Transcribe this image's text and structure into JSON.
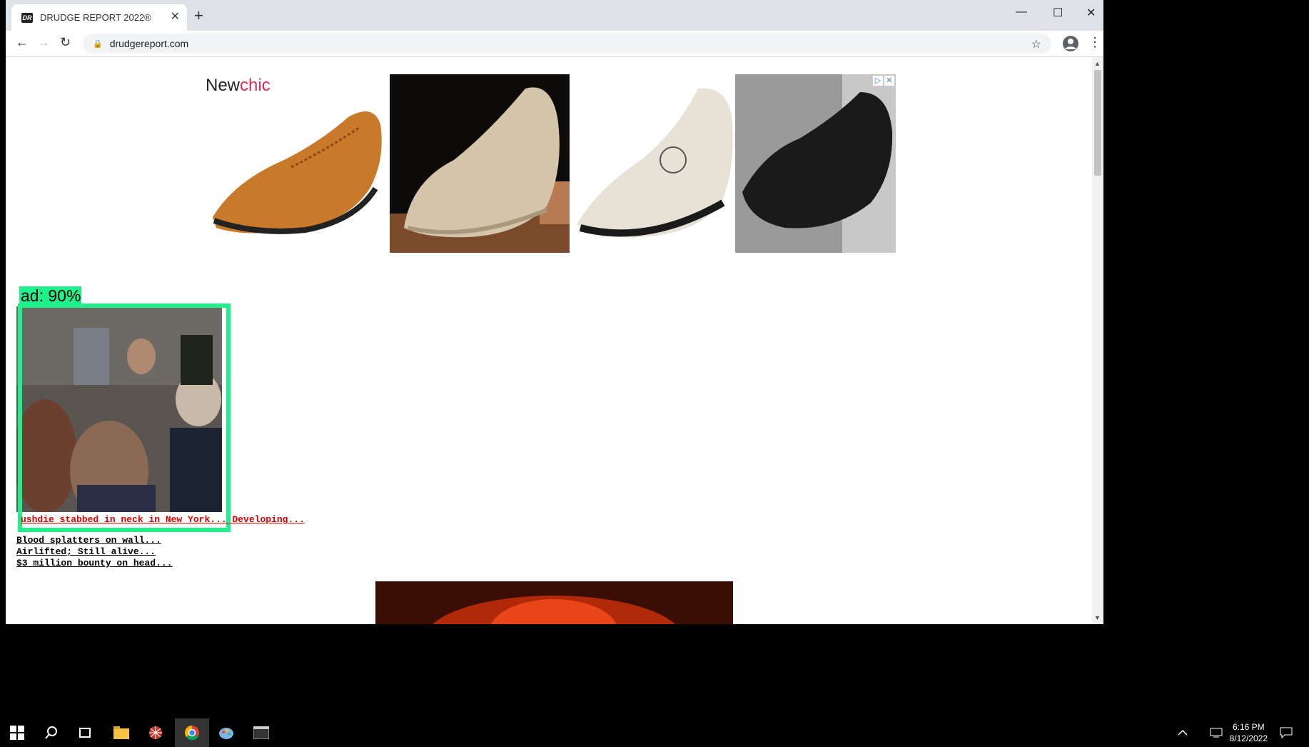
{
  "browser": {
    "tab_title": "DRUDGE REPORT 2022®",
    "favicon_text": "DR",
    "new_tab_glyph": "+",
    "close_glyph": "✕",
    "url": "drudgereport.com",
    "window_controls": {
      "minimize": "—",
      "maximize": "☐",
      "close": "✕"
    },
    "nav": {
      "back": "←",
      "forward": "→",
      "reload": "↻",
      "star": "☆",
      "menu": "⋮",
      "lock": "🔒"
    }
  },
  "ad": {
    "brand_prefix": "New",
    "brand_suffix": "chic",
    "adchoices": [
      "▷",
      "✕"
    ]
  },
  "detection": {
    "label": "ad: 90%"
  },
  "headlines": [
    {
      "text": "ushdie stabbed in neck in New York... Developing...",
      "color": "#dd0000"
    },
    {
      "text": "Blood splatters on wall...",
      "color": "#000000"
    },
    {
      "text": "Airlifted; Still alive...",
      "color": "#000000"
    },
    {
      "text": "$3 million bounty on head...",
      "color": "#000000"
    }
  ],
  "taskbar": {
    "time": "6:16 PM",
    "date": "8/12/2022",
    "icons": [
      "windows-start-icon",
      "search-icon",
      "task-view-icon",
      "file-explorer-icon",
      "network-app-icon",
      "chrome-icon",
      "paint-icon",
      "terminal-icon"
    ]
  }
}
